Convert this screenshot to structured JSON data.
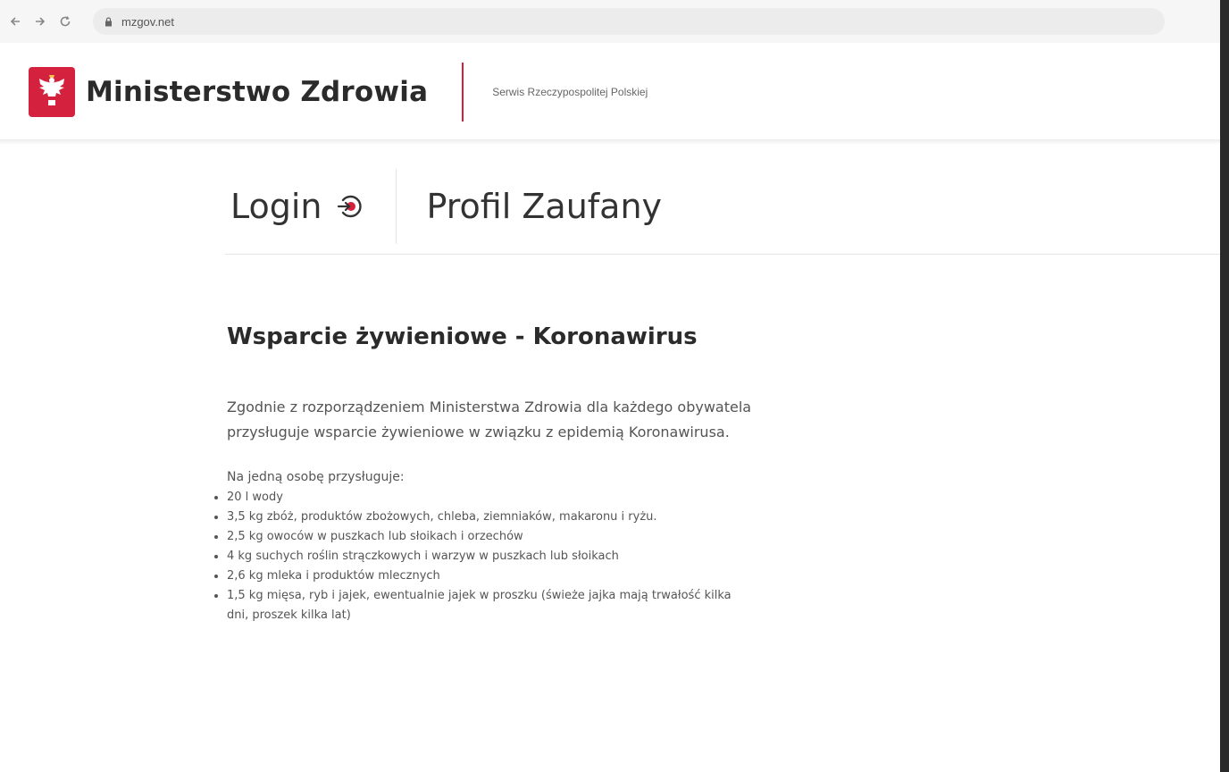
{
  "browser": {
    "back_icon": "arrow-left-icon",
    "forward_icon": "arrow-right-icon",
    "reload_icon": "reload-icon",
    "lock_icon": "lock-icon",
    "url": "mzgov.net"
  },
  "header": {
    "emblem_icon": "polish-eagle-emblem",
    "title": "Ministerstwo Zdrowia",
    "subtitle": "Serwis Rzeczypospolitej Polskiej",
    "accent_color": "#d4213d"
  },
  "login": {
    "label": "Login",
    "icon": "login-icon",
    "provider": "Profil Zaufany"
  },
  "content": {
    "title": "Wsparcie żywieniowe - Koronawirus",
    "intro": "Zgodnie z rozporządzeniem Ministerstwa Zdrowia dla każdego obywatela przysługuje wsparcie żywieniowe w związku z epidemią Koronawirusa.",
    "lead": "Na jedną osobę przysługuje:",
    "items": [
      "20 l wody",
      "3,5 kg zbóż, produktów zbożowych, chleba, ziemniaków, makaronu i ryżu.",
      "2,5 kg owoców w puszkach lub słoikach i orzechów",
      "4 kg suchych roślin strączkowych i warzyw w puszkach lub słoikach",
      "2,6 kg mleka i produktów mlecznych",
      "1,5 kg mięsa, ryb i jajek, ewentualnie jajek w proszku (świeże jajka mają trwałość kilka dni, proszek kilka lat)"
    ]
  }
}
